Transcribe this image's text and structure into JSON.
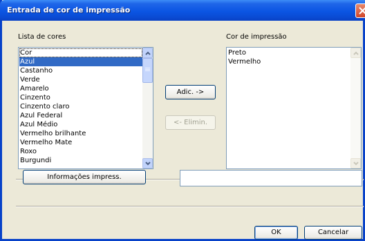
{
  "window": {
    "title": "Entrada de cor de impressão"
  },
  "left_list": {
    "label": "Lista de cores",
    "items": [
      "Cor",
      "Azul",
      "Castanho",
      "Verde",
      "Amarelo",
      "Cinzento",
      "Cinzento claro",
      "Azul Federal",
      "Azul Médio",
      "Vermelho brilhante",
      "Vermelho Mate",
      "Roxo",
      "Burgundi"
    ],
    "selected": "Azul"
  },
  "right_list": {
    "label": "Cor de impressão",
    "items": [
      "Preto",
      "Vermelho"
    ]
  },
  "buttons": {
    "add": "Adic. ->",
    "remove": "<- Elimin.",
    "print_info": "Informações impress.",
    "ok": "OK",
    "cancel": "Cancelar"
  },
  "info_field": {
    "value": ""
  },
  "icons": {
    "close": "close-icon",
    "scroll_up": "chevron-up-icon",
    "scroll_down": "chevron-down-icon"
  },
  "colors": {
    "titlebar": "#0b55e3",
    "selection": "#316ac5",
    "dialog_bg": "#ece9d8",
    "close_button": "#d2462a"
  }
}
